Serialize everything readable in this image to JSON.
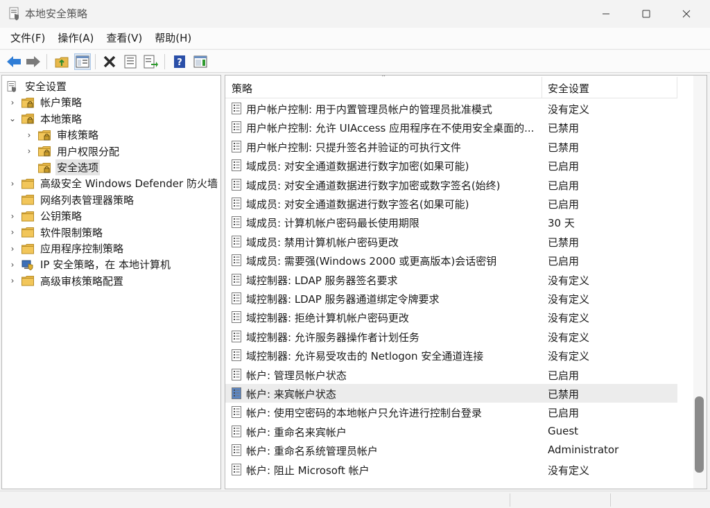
{
  "window": {
    "title": "本地安全策略"
  },
  "menu": [
    "文件(F)",
    "操作(A)",
    "查看(V)",
    "帮助(H)"
  ],
  "toolbar": {
    "icons": [
      "back-icon",
      "forward-icon",
      "up-folder-icon",
      "show-hide-tree-icon",
      "delete-icon",
      "properties-icon",
      "export-list-icon",
      "help-icon",
      "show-hide-action-pane-icon"
    ]
  },
  "tree": [
    {
      "label": "安全设置",
      "level": 0,
      "chev": "",
      "icon": "shield-doc-icon"
    },
    {
      "label": "帐户策略",
      "level": 1,
      "chev": "›",
      "icon": "folder-lock-icon"
    },
    {
      "label": "本地策略",
      "level": 1,
      "chev": "⌄",
      "icon": "folder-lock-icon"
    },
    {
      "label": "审核策略",
      "level": 2,
      "chev": "›",
      "icon": "folder-lock-icon"
    },
    {
      "label": "用户权限分配",
      "level": 2,
      "chev": "›",
      "icon": "folder-lock-icon"
    },
    {
      "label": "安全选项",
      "level": 2,
      "chev": "",
      "icon": "folder-lock-icon",
      "selected": true
    },
    {
      "label": "高级安全 Windows Defender 防火墙",
      "level": 1,
      "chev": "›",
      "icon": "folder-icon"
    },
    {
      "label": "网络列表管理器策略",
      "level": 1,
      "chev": "",
      "icon": "folder-icon"
    },
    {
      "label": "公钥策略",
      "level": 1,
      "chev": "›",
      "icon": "folder-icon"
    },
    {
      "label": "软件限制策略",
      "level": 1,
      "chev": "›",
      "icon": "folder-icon"
    },
    {
      "label": "应用程序控制策略",
      "level": 1,
      "chev": "›",
      "icon": "folder-icon"
    },
    {
      "label": "IP 安全策略，在 本地计算机",
      "level": 1,
      "chev": "›",
      "icon": "ip-security-icon"
    },
    {
      "label": "高级审核策略配置",
      "level": 1,
      "chev": "›",
      "icon": "folder-icon"
    }
  ],
  "list": {
    "columns": {
      "policy": "策略",
      "setting": "安全设置"
    },
    "rows": [
      {
        "name": "用户帐户控制: 用于内置管理员帐户的管理员批准模式",
        "value": "没有定义"
      },
      {
        "name": "用户帐户控制: 允许 UIAccess 应用程序在不使用安全桌面的...",
        "value": "已禁用"
      },
      {
        "name": "用户帐户控制: 只提升签名并验证的可执行文件",
        "value": "已禁用"
      },
      {
        "name": "域成员: 对安全通道数据进行数字加密(如果可能)",
        "value": "已启用"
      },
      {
        "name": "域成员: 对安全通道数据进行数字加密或数字签名(始终)",
        "value": "已启用"
      },
      {
        "name": "域成员: 对安全通道数据进行数字签名(如果可能)",
        "value": "已启用"
      },
      {
        "name": "域成员: 计算机帐户密码最长使用期限",
        "value": "30 天"
      },
      {
        "name": "域成员: 禁用计算机帐户密码更改",
        "value": "已禁用"
      },
      {
        "name": "域成员: 需要强(Windows 2000 或更高版本)会话密钥",
        "value": "已启用"
      },
      {
        "name": "域控制器: LDAP 服务器签名要求",
        "value": "没有定义"
      },
      {
        "name": "域控制器: LDAP 服务器通道绑定令牌要求",
        "value": "没有定义"
      },
      {
        "name": "域控制器: 拒绝计算机帐户密码更改",
        "value": "没有定义"
      },
      {
        "name": "域控制器: 允许服务器操作者计划任务",
        "value": "没有定义"
      },
      {
        "name": "域控制器: 允许易受攻击的 Netlogon 安全通道连接",
        "value": "没有定义"
      },
      {
        "name": "帐户: 管理员帐户状态",
        "value": "已启用"
      },
      {
        "name": "帐户: 来宾帐户状态",
        "value": "已禁用",
        "selected": true
      },
      {
        "name": "帐户: 使用空密码的本地帐户只允许进行控制台登录",
        "value": "已启用"
      },
      {
        "name": "帐户: 重命名来宾帐户",
        "value": "Guest"
      },
      {
        "name": "帐户: 重命名系统管理员帐户",
        "value": "Administrator"
      },
      {
        "name": "帐户: 阻止 Microsoft 帐户",
        "value": "没有定义"
      }
    ]
  },
  "colors": {
    "folder": "#e8b84a",
    "lock": "#c79a2a",
    "arrow": "#2f7dd6",
    "selection": "#e5e5e5"
  }
}
